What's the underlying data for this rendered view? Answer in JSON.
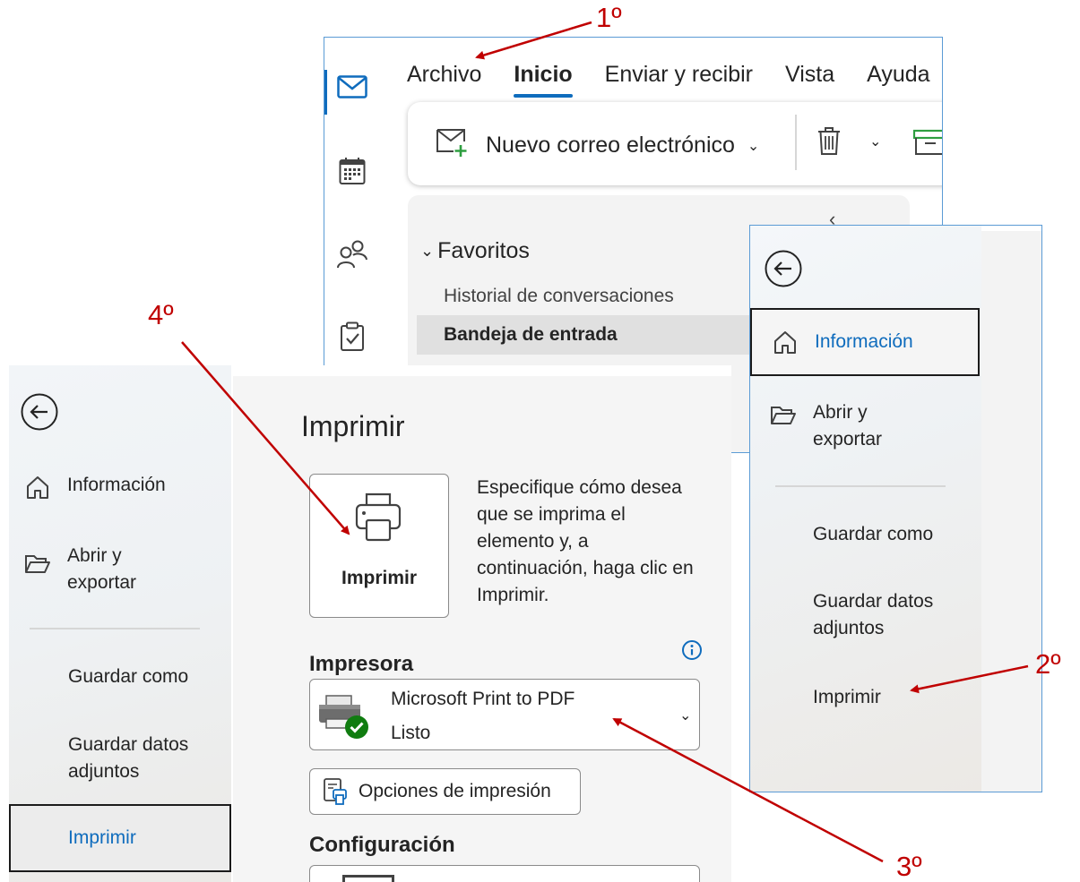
{
  "outlook_window": {
    "tabs": [
      "Archivo",
      "Inicio",
      "Enviar y recibir",
      "Vista",
      "Ayuda"
    ],
    "selected_tab": "Inicio",
    "ribbon": {
      "new_mail_label": "Nuevo correo electrónico"
    },
    "folders": {
      "group_label": "Favoritos",
      "items": [
        "Historial de conversaciones",
        "Bandeja de entrada"
      ]
    }
  },
  "right_backstage": {
    "nav": {
      "info": "Información",
      "open_export_line1": "Abrir y",
      "open_export_line2": "exportar",
      "save_as": "Guardar como",
      "save_attachments_line1": "Guardar datos",
      "save_attachments_line2": "adjuntos",
      "print": "Imprimir"
    },
    "selected": "Información"
  },
  "print_backstage": {
    "nav": {
      "info": "Información",
      "open_export_line1": "Abrir y",
      "open_export_line2": "exportar",
      "save_as": "Guardar como",
      "save_attachments_line1": "Guardar datos",
      "save_attachments_line2": "adjuntos",
      "print": "Imprimir"
    },
    "selected": "Imprimir",
    "title": "Imprimir",
    "print_button_label": "Imprimir",
    "description_lines": [
      "Especifique cómo desea",
      "que se imprima el",
      "elemento y, a",
      "continuación, haga clic en",
      "Imprimir."
    ],
    "printer_section_label": "Impresora",
    "printer": {
      "name": "Microsoft Print to PDF",
      "status": "Listo"
    },
    "print_options_label": "Opciones de impresión",
    "settings_section_label": "Configuración"
  },
  "annotations": {
    "color": "#c00000",
    "steps": [
      "1º",
      "2º",
      "3º",
      "4º"
    ]
  },
  "colors": {
    "accent": "#0f6cbd",
    "frame": "#5b9bd5",
    "annotation": "#c00000"
  }
}
